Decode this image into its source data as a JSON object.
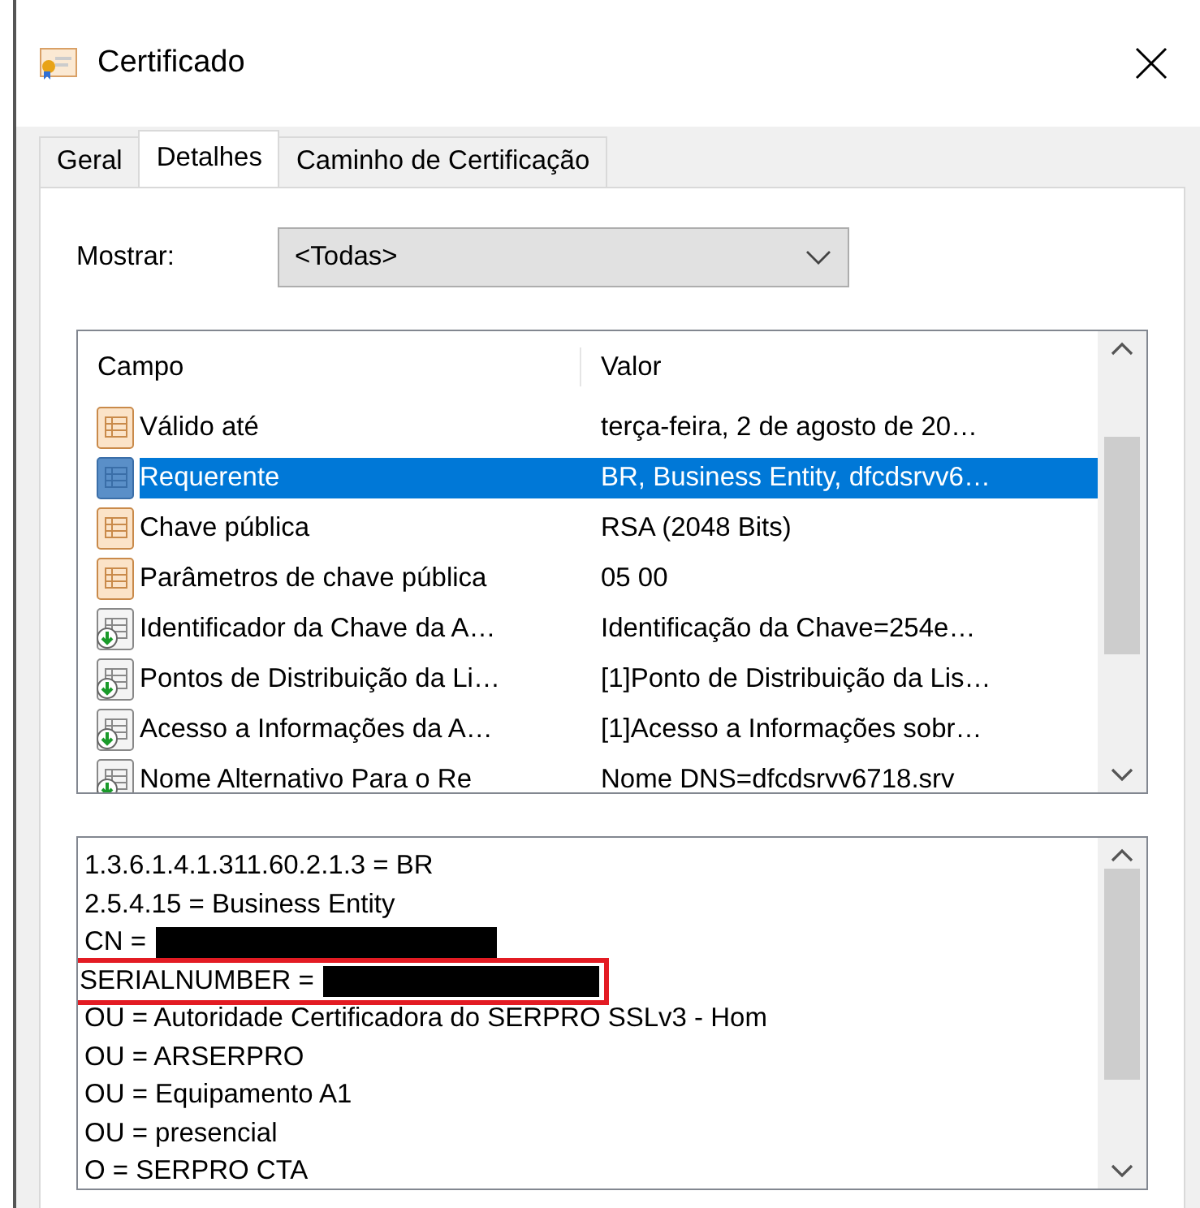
{
  "window": {
    "title": "Certificado"
  },
  "tabs": [
    {
      "label": "Geral",
      "selected": false
    },
    {
      "label": "Detalhes",
      "selected": true
    },
    {
      "label": "Caminho de Certificação",
      "selected": false
    }
  ],
  "show": {
    "label": "Mostrar:",
    "value": "<Todas>"
  },
  "fields": {
    "columns": [
      "Campo",
      "Valor"
    ],
    "rows": [
      {
        "kind": "property",
        "field": "Válido até",
        "value": "terça-feira, 2 de agosto de 20…",
        "selected": false
      },
      {
        "kind": "property",
        "field": "Requerente",
        "value": "BR, Business Entity, dfcdsrvv6…",
        "selected": true
      },
      {
        "kind": "property",
        "field": "Chave pública",
        "value": "RSA (2048 Bits)",
        "selected": false
      },
      {
        "kind": "property",
        "field": "Parâmetros de chave pública",
        "value": "05 00",
        "selected": false
      },
      {
        "kind": "extension",
        "field": "Identificador da Chave da A…",
        "value": "Identificação da Chave=254e…",
        "selected": false
      },
      {
        "kind": "extension",
        "field": "Pontos de Distribuição da Li…",
        "value": "[1]Ponto de Distribuição da Lis…",
        "selected": false
      },
      {
        "kind": "extension",
        "field": "Acesso a Informações da A…",
        "value": "[1]Acesso a Informações sobr…",
        "selected": false
      },
      {
        "kind": "extension",
        "field": "Nome Alternativo Para o Re",
        "value": "Nome DNS=dfcdsrvv6718.srv",
        "selected": false
      }
    ]
  },
  "details": [
    {
      "text": "1.3.6.1.4.1.311.60.2.1.3 = BR",
      "redacted": false,
      "highlighted": false
    },
    {
      "text": "2.5.4.15 = Business Entity",
      "redacted": false,
      "highlighted": false
    },
    {
      "text": "CN =",
      "redacted": true,
      "highlighted": false
    },
    {
      "text": "SERIALNUMBER =",
      "redacted": true,
      "highlighted": true
    },
    {
      "text": "OU = Autoridade Certificadora do SERPRO SSLv3 - Hom",
      "redacted": false,
      "highlighted": false
    },
    {
      "text": "OU = ARSERPRO",
      "redacted": false,
      "highlighted": false
    },
    {
      "text": "OU = Equipamento A1",
      "redacted": false,
      "highlighted": false
    },
    {
      "text": "OU = presencial",
      "redacted": false,
      "highlighted": false
    },
    {
      "text": "O = SERPRO CTA",
      "redacted": false,
      "highlighted": false
    }
  ]
}
